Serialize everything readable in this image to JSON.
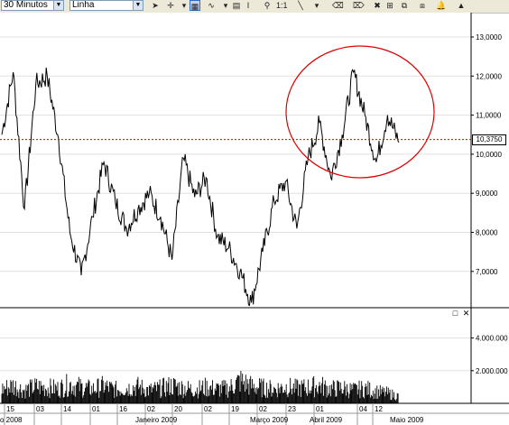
{
  "toolbar": {
    "interval_value": "30 Minutos",
    "chart_type_value": "Linha",
    "buttons": [
      {
        "name": "pointer-tool-icon",
        "glyph": "➤"
      },
      {
        "name": "crosshair-tool-icon",
        "glyph": "✛"
      },
      {
        "name": "dropdown-arrow-icon",
        "glyph": "▾"
      },
      {
        "name": "grid-toggle-icon",
        "glyph": "▦"
      },
      {
        "name": "indicator-tool-icon",
        "glyph": "∿"
      },
      {
        "name": "dropdown-arrow-icon",
        "glyph": "▾"
      },
      {
        "name": "data-window-icon",
        "glyph": "▤"
      },
      {
        "name": "cursor-text-icon",
        "glyph": "I"
      },
      {
        "name": "zoom-icon",
        "glyph": "⚲"
      },
      {
        "name": "scale-1to1-icon",
        "glyph": "1:1"
      },
      {
        "name": "line-draw-icon",
        "glyph": "╲"
      },
      {
        "name": "dropdown-arrow-icon",
        "glyph": "▾"
      },
      {
        "name": "eraser-icon",
        "glyph": "⌫"
      },
      {
        "name": "eraser-all-icon",
        "glyph": "⌦"
      },
      {
        "name": "hide-drawings-icon",
        "glyph": "✖"
      },
      {
        "name": "snap-icon",
        "glyph": "⊞"
      },
      {
        "name": "copy-chart-icon",
        "glyph": "⧉"
      },
      {
        "name": "template-icon",
        "glyph": "⧈"
      },
      {
        "name": "alert-bell-icon",
        "glyph": "🔔"
      }
    ],
    "up_arrow": "▲"
  },
  "price_axis": {
    "ticks": [
      {
        "value": 13,
        "label": "13,0000"
      },
      {
        "value": 12,
        "label": "12,0000"
      },
      {
        "value": 11,
        "label": "11,0000"
      },
      {
        "value": 10,
        "label": "10,0000"
      },
      {
        "value": 9,
        "label": "9,0000"
      },
      {
        "value": 8,
        "label": "8,0000"
      },
      {
        "value": 7,
        "label": "7,0000"
      }
    ],
    "last_price_label": "10,3750"
  },
  "volume_axis": {
    "ticks": [
      {
        "value": 4000,
        "label": "4.000.000"
      },
      {
        "value": 2000,
        "label": "2.000.000"
      }
    ]
  },
  "volume_panel_controls": {
    "restore": "□",
    "close": "✕"
  },
  "time_axis": {
    "ticks": [
      "15",
      "03",
      "14",
      "01",
      "16",
      "02",
      "20",
      "02",
      "19",
      "02",
      "23",
      "01",
      "04",
      "12"
    ],
    "months": [
      "o 2008",
      "Janeiro 2009",
      "Março 2009",
      "Abril 2009",
      "Maio 2009"
    ]
  },
  "chart_data": {
    "type": "line",
    "title": "",
    "xlabel": "",
    "ylabel": "",
    "ylim": [
      6.2,
      13.6
    ],
    "last_price": 10.375,
    "x": [
      "15",
      "",
      "03",
      "",
      "14",
      "",
      "",
      "",
      "01",
      "",
      "",
      "16",
      "",
      "",
      "02",
      "",
      "",
      "20",
      "",
      "02",
      "",
      "",
      "19",
      "",
      "02",
      "",
      "23",
      "",
      "01",
      "",
      "",
      "04",
      "",
      "12",
      "",
      ""
    ],
    "values": [
      10.5,
      12.1,
      8.6,
      11.8,
      12.0,
      10.4,
      8.0,
      6.9,
      8.4,
      9.8,
      8.8,
      8.1,
      8.6,
      9.0,
      8.4,
      7.3,
      9.9,
      8.9,
      9.4,
      7.9,
      7.6,
      7.0,
      6.2,
      7.5,
      8.8,
      9.3,
      8.1,
      9.9,
      10.8,
      9.4,
      10.5,
      12.1,
      11.0,
      9.8,
      11.0,
      10.3
    ],
    "volume": {
      "ylim": [
        0,
        5800
      ],
      "values": [
        1200,
        1500,
        1100,
        1400,
        1300,
        1250,
        1600,
        1350,
        1200,
        1450,
        1150,
        1300,
        1400,
        1100,
        1250,
        1500,
        1300,
        1150,
        1350,
        1200,
        1250,
        1900,
        1450,
        1300,
        1200,
        1400,
        1250,
        1350,
        1500,
        1200,
        1300,
        1100,
        1250,
        1000,
        850,
        600
      ]
    }
  }
}
